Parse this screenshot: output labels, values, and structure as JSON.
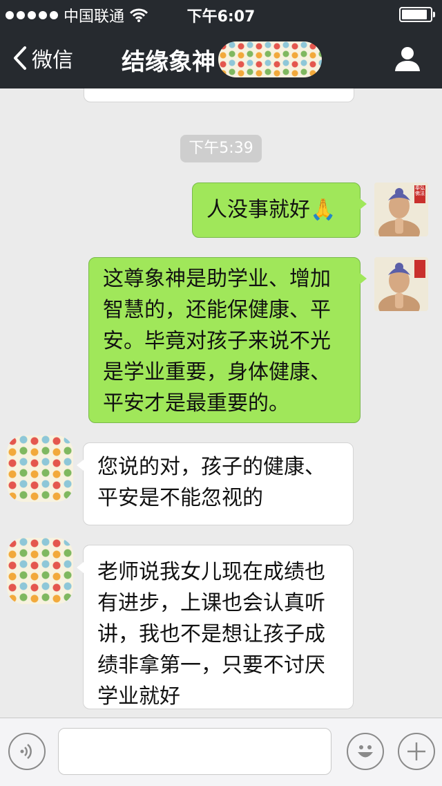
{
  "status_bar": {
    "carrier": "中国联通",
    "time": "下午6:07",
    "signal_icon": "signal-dots-icon",
    "wifi_icon": "wifi-icon",
    "battery_icon": "battery-icon"
  },
  "nav": {
    "back_label": "微信",
    "title": "结缘象神",
    "profile_icon": "user-icon"
  },
  "chat": {
    "timestamp": "下午5:39",
    "messages": [
      {
        "side": "out",
        "text": "人没事就好🙏"
      },
      {
        "side": "out",
        "text": "这尊象神是助学业、增加\n智慧的，还能保健康、平\n安。毕竟对孩子来说不光\n是学业重要，身体健康、\n平安才是最重要的。"
      },
      {
        "side": "in",
        "text": "您说的对，孩子的健康、\n平安是不能忽视的"
      },
      {
        "side": "in",
        "text": "老师说我女儿现在成绩也\n有进步，上课也会认真听\n讲，我也不是想让孩子成\n绩非拿第一，只要不讨厌\n学业就好"
      }
    ],
    "badge_text": "奉弘佛法"
  },
  "input_bar": {
    "voice_icon": "voice-icon",
    "emoji_icon": "emoji-icon",
    "plus_icon": "plus-icon",
    "input_value": ""
  },
  "colors": {
    "header": "#262a2f",
    "outgoing_bubble": "#a0e75a",
    "incoming_bubble": "#ffffff",
    "chat_background": "#ebebeb"
  }
}
